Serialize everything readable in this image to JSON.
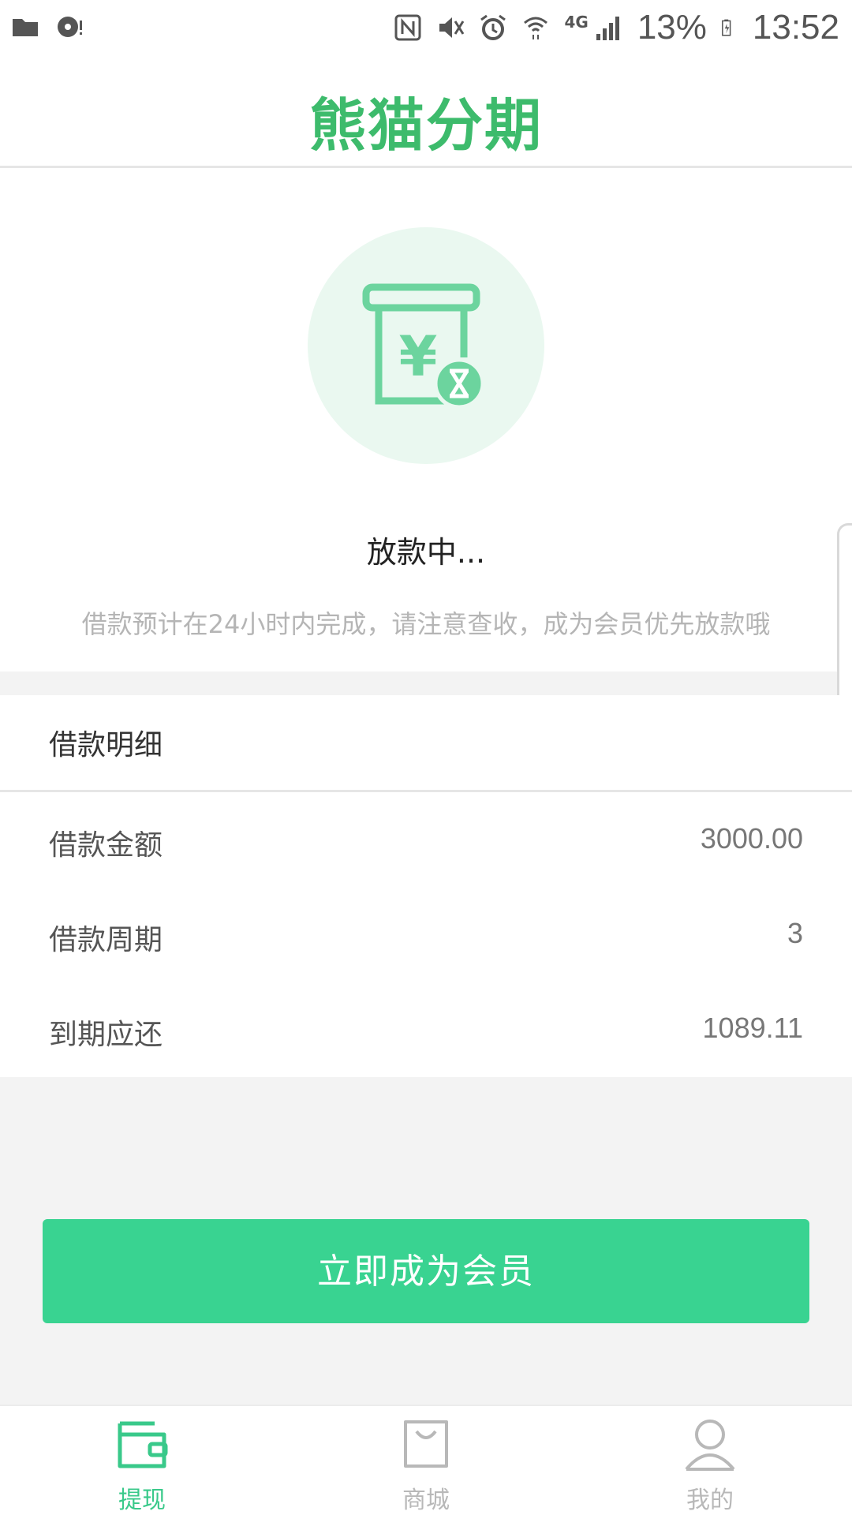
{
  "status_bar": {
    "battery": "13%",
    "time": "13:52",
    "network": "4G",
    "icons": [
      "folder-icon",
      "record-icon",
      "nfc-icon",
      "mute-icon",
      "alarm-icon",
      "wifi-icon",
      "signal-icon",
      "battery-icon"
    ]
  },
  "header": {
    "logo_text": "熊猫分期"
  },
  "status": {
    "title": "放款中...",
    "subtitle": "借款预计在24小时内完成，请注意查收，成为会员优先放款哦",
    "icon": "loan-pending-icon"
  },
  "details": {
    "title": "借款明细",
    "rows": [
      {
        "label": "借款金额",
        "value": "3000.00"
      },
      {
        "label": "借款周期",
        "value": "3"
      },
      {
        "label": "到期应还",
        "value": "1089.11"
      }
    ]
  },
  "cta": {
    "label": "立即成为会员"
  },
  "tabs": [
    {
      "label": "提现",
      "icon": "wallet-icon",
      "active": true
    },
    {
      "label": "商城",
      "icon": "shopping-bag-icon",
      "active": false
    },
    {
      "label": "我的",
      "icon": "person-icon",
      "active": false
    }
  ],
  "colors": {
    "accent": "#39d391",
    "logo": "#3dbb6c",
    "tab_active": "#39c98a",
    "tab_inactive": "#b8b8b8"
  }
}
